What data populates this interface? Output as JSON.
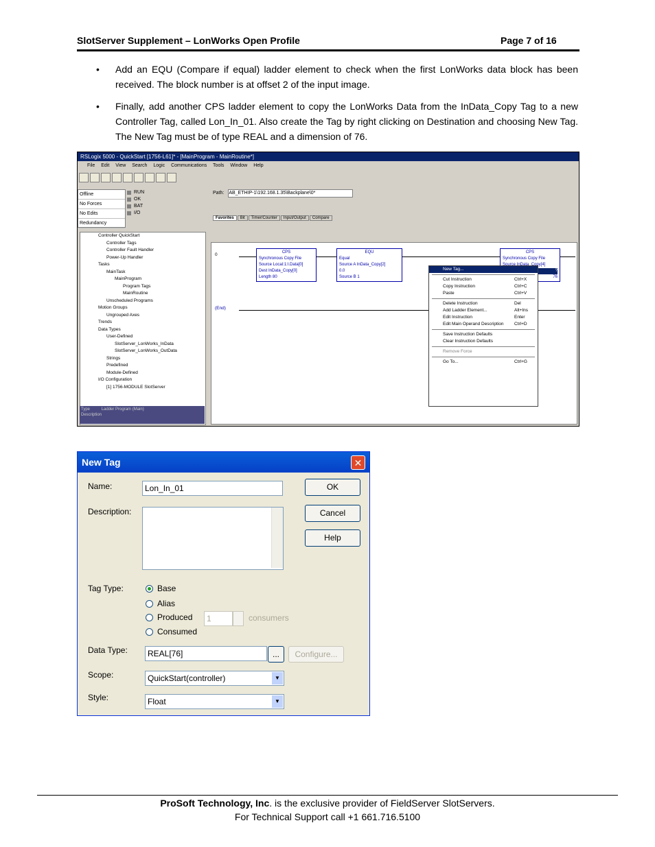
{
  "header": {
    "title": "SlotServer Supplement – LonWorks Open Profile",
    "page": "Page 7 of 16"
  },
  "bullets": [
    "Add an EQU (Compare if equal) ladder element to check when the first LonWorks data block has been received.  The block number is at offset 2 of the input image.",
    "Finally, add another CPS ladder element to copy the LonWorks Data from the InData_Copy Tag to a new Controller Tag, called Lon_In_01.  Also create the Tag by right clicking on Destination and choosing New Tag. The New Tag must be of type REAL and a dimension of 76."
  ],
  "rslogix": {
    "title": "RSLogix 5000 - QuickStart [1756-L61]* - [MainProgram - MainRoutine*]",
    "menu": [
      "File",
      "Edit",
      "View",
      "Search",
      "Logic",
      "Communications",
      "Tools",
      "Window",
      "Help"
    ],
    "status": [
      "Offline",
      "No Forces",
      "No Edits",
      "Redundancy"
    ],
    "leds": [
      "RUN",
      "OK",
      "BAT",
      "I/O"
    ],
    "path_label": "Path:",
    "path": "AB_ETHIP-1\\192.168.1.35\\Backplane\\0*",
    "tabs": [
      "Favorites",
      "Bit",
      "Timer/Counter",
      "Input/Output",
      "Compare"
    ],
    "tree": [
      "Controller QuickStart",
      "Controller Tags",
      "Controller Fault Handler",
      "Power-Up Handler",
      "Tasks",
      "MainTask",
      "MainProgram",
      "Program Tags",
      "MainRoutine",
      "Unscheduled Programs",
      "Motion Groups",
      "Ungrouped Axes",
      "Trends",
      "Data Types",
      "User-Defined",
      "SlotServer_LonWorks_InData",
      "SlotServer_LonWorks_OutData",
      "Strings",
      "Predefined",
      "Module-Defined",
      "I/O Configuration",
      "[1] 1756-MODULE SlotServer"
    ],
    "props": [
      "Type",
      "Ladder Program (Main)",
      "Description"
    ],
    "ladder": {
      "rung0": "0",
      "end": "(End)",
      "cps1": {
        "name": "CPS",
        "lines": [
          "Synchronous Copy File",
          "Source   Local:1:I.Data[0]",
          "Dest      InData_Copy[0]",
          "Length                        80"
        ]
      },
      "equ": {
        "name": "EQU",
        "lines": [
          "Equal",
          "Source A   InData_Copy[2]",
          "                                  0.0",
          "Source B                        1"
        ]
      },
      "cps2": {
        "name": "CPS",
        "lines": [
          "Synchronous Copy File",
          "Source   InData_Copy[4]",
          "?",
          "76"
        ]
      }
    },
    "context_menu": [
      {
        "label": "New Tag...",
        "shortcut": ""
      },
      {
        "label": "Cut Instruction",
        "shortcut": "Ctrl+X"
      },
      {
        "label": "Copy Instruction",
        "shortcut": "Ctrl+C"
      },
      {
        "label": "Paste",
        "shortcut": "Ctrl+V"
      },
      {
        "label": "Delete Instruction",
        "shortcut": "Del"
      },
      {
        "label": "Add Ladder Element...",
        "shortcut": "Alt+Ins"
      },
      {
        "label": "Edit Instruction",
        "shortcut": "Enter"
      },
      {
        "label": "Edit Main Operand Description",
        "shortcut": "Ctrl+D"
      },
      {
        "label": "Save Instruction Defaults",
        "shortcut": ""
      },
      {
        "label": "Clear Instruction Defaults",
        "shortcut": ""
      },
      {
        "label": "Remove Force",
        "shortcut": ""
      },
      {
        "label": "Go To...",
        "shortcut": "Ctrl+G"
      }
    ]
  },
  "dialog": {
    "title": "New Tag",
    "close": "✕",
    "name_label": "Name:",
    "name_value": "Lon_In_01",
    "desc_label": "Description:",
    "ok": "OK",
    "cancel": "Cancel",
    "help": "Help",
    "tagtype_label": "Tag Type:",
    "tag_types": [
      "Base",
      "Alias",
      "Produced",
      "Consumed"
    ],
    "selected_tag_type": "Base",
    "consumers_value": "1",
    "consumers_label": "consumers",
    "datatype_label": "Data Type:",
    "datatype_value": "REAL[76]",
    "browse": "...",
    "configure": "Configure...",
    "scope_label": "Scope:",
    "scope_value": "QuickStart(controller)",
    "style_label": "Style:",
    "style_value": "Float"
  },
  "footer": {
    "company": "ProSoft Technology, Inc",
    "line1_rest": ". is the exclusive provider of FieldServer SlotServers.",
    "line2": "For Technical Support call +1 661.716.5100"
  }
}
